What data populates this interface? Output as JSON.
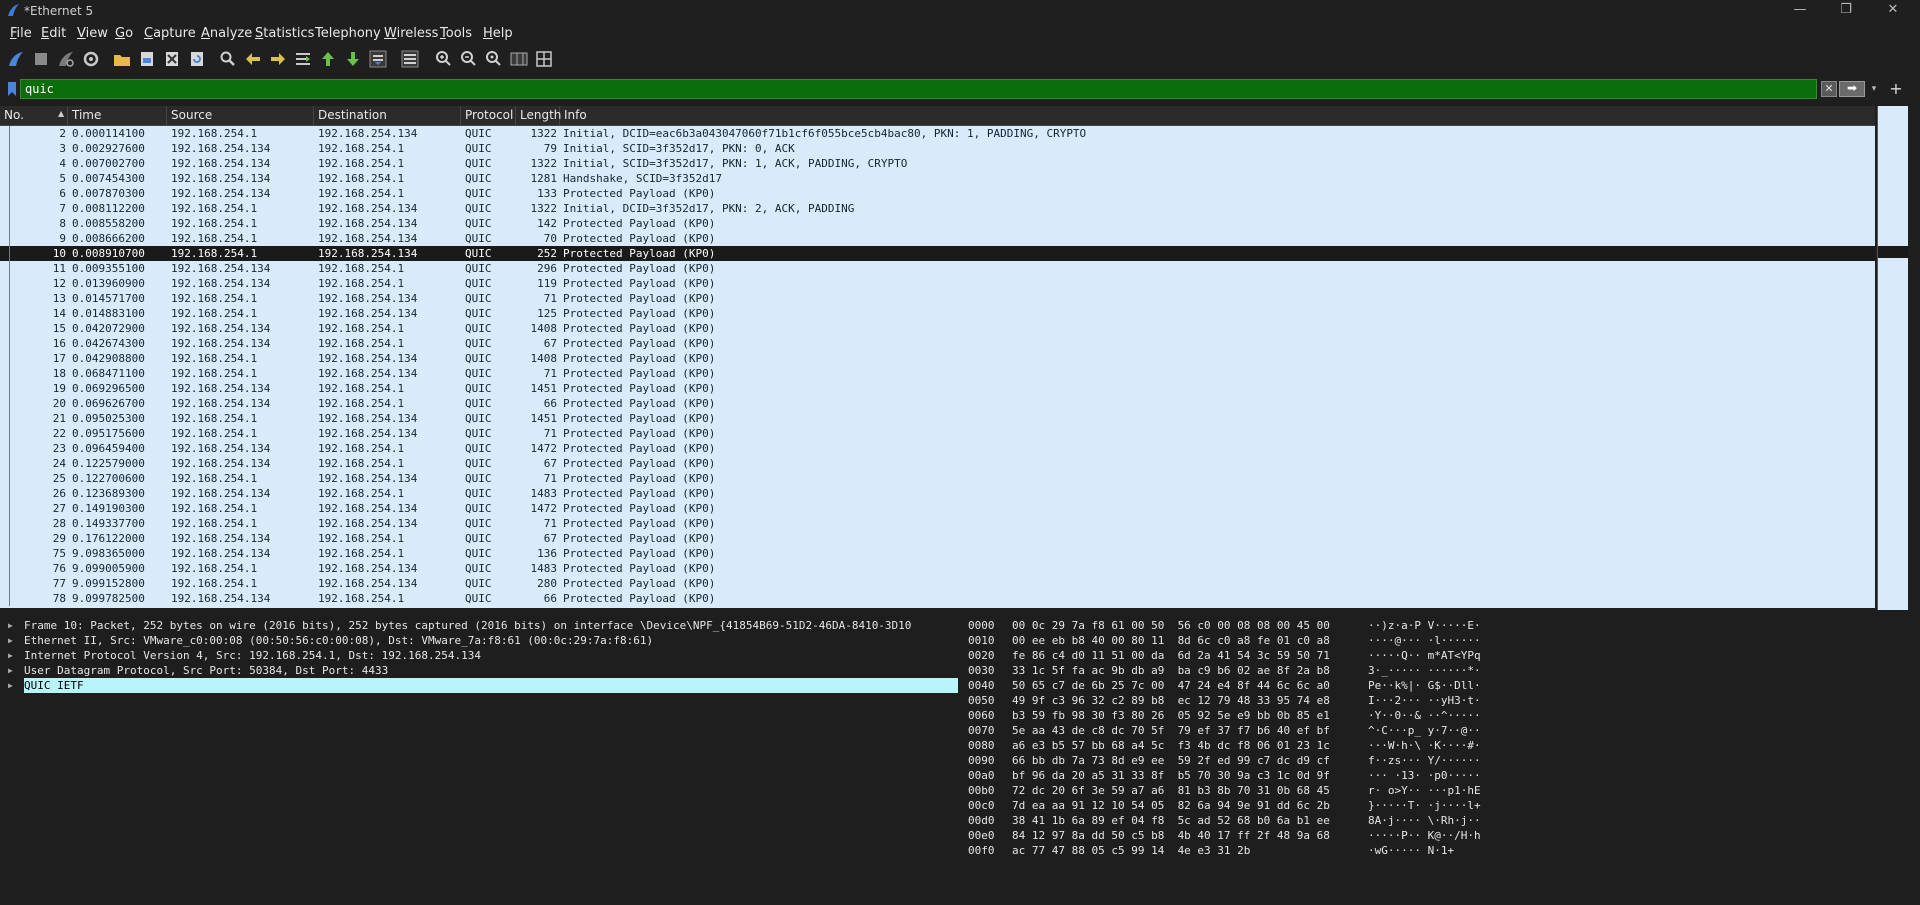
{
  "window": {
    "title": "*Ethernet 5",
    "minimize": "—",
    "maximize": "❐",
    "close": "✕"
  },
  "menu": [
    {
      "label": "File",
      "underline": "F",
      "rest": "ile"
    },
    {
      "label": "Edit",
      "underline": "E",
      "rest": "dit"
    },
    {
      "label": "View",
      "underline": "V",
      "rest": "iew"
    },
    {
      "label": "Go",
      "underline": "G",
      "rest": "o"
    },
    {
      "label": "Capture",
      "underline": "C",
      "rest": "apture"
    },
    {
      "label": "Analyze",
      "underline": "A",
      "rest": "nalyze"
    },
    {
      "label": "Statistics",
      "underline": "S",
      "rest": "tatistics"
    },
    {
      "label": "Telephony",
      "underline": "",
      "rest": "Telephony"
    },
    {
      "label": "Wireless",
      "underline": "W",
      "rest": "ireless"
    },
    {
      "label": "Tools",
      "underline": "T",
      "rest": "ools"
    },
    {
      "label": "Help",
      "underline": "H",
      "rest": "elp"
    }
  ],
  "toolbar_icons": [
    "shark-fin-start-icon",
    "stop-square-icon",
    "restart-fin-icon",
    "options-gear-icon",
    "open-folder-icon",
    "save-file-icon",
    "close-file-icon",
    "reload-icon",
    "find-packet-icon",
    "go-back-icon",
    "go-forward-icon",
    "go-to-packet-icon",
    "go-first-icon",
    "go-last-icon",
    "autoscroll-icon",
    "colorize-icon",
    "zoom-in-icon",
    "zoom-out-icon",
    "zoom-normal-icon",
    "resize-columns-icon",
    "layout-icon"
  ],
  "filter": {
    "value": "quic",
    "clear": "✕",
    "apply": "➡",
    "dropdown": "▾",
    "add": "+"
  },
  "columns": [
    "No.",
    "Time",
    "Source",
    "Destination",
    "Protocol",
    "Length",
    "Info"
  ],
  "packets": [
    {
      "no": "2",
      "time": "0.000114100",
      "src": "192.168.254.1",
      "dst": "192.168.254.134",
      "proto": "QUIC",
      "len": "1322",
      "info": "Initial, DCID=eac6b3a043047060f71b1cf6f055bce5cb4bac80, PKN: 1, PADDING, CRYPTO"
    },
    {
      "no": "3",
      "time": "0.002927600",
      "src": "192.168.254.134",
      "dst": "192.168.254.1",
      "proto": "QUIC",
      "len": "79",
      "info": "Initial, SCID=3f352d17, PKN: 0, ACK"
    },
    {
      "no": "4",
      "time": "0.007002700",
      "src": "192.168.254.134",
      "dst": "192.168.254.1",
      "proto": "QUIC",
      "len": "1322",
      "info": "Initial, SCID=3f352d17, PKN: 1, ACK, PADDING, CRYPTO"
    },
    {
      "no": "5",
      "time": "0.007454300",
      "src": "192.168.254.134",
      "dst": "192.168.254.1",
      "proto": "QUIC",
      "len": "1281",
      "info": "Handshake, SCID=3f352d17"
    },
    {
      "no": "6",
      "time": "0.007870300",
      "src": "192.168.254.134",
      "dst": "192.168.254.1",
      "proto": "QUIC",
      "len": "133",
      "info": "Protected Payload (KP0)"
    },
    {
      "no": "7",
      "time": "0.008112200",
      "src": "192.168.254.1",
      "dst": "192.168.254.134",
      "proto": "QUIC",
      "len": "1322",
      "info": "Initial, DCID=3f352d17, PKN: 2, ACK, PADDING"
    },
    {
      "no": "8",
      "time": "0.008558200",
      "src": "192.168.254.1",
      "dst": "192.168.254.134",
      "proto": "QUIC",
      "len": "142",
      "info": "Protected Payload (KP0)"
    },
    {
      "no": "9",
      "time": "0.008666200",
      "src": "192.168.254.1",
      "dst": "192.168.254.134",
      "proto": "QUIC",
      "len": "70",
      "info": "Protected Payload (KP0)"
    },
    {
      "no": "10",
      "time": "0.008910700",
      "src": "192.168.254.1",
      "dst": "192.168.254.134",
      "proto": "QUIC",
      "len": "252",
      "info": "Protected Payload (KP0)",
      "selected": true
    },
    {
      "no": "11",
      "time": "0.009355100",
      "src": "192.168.254.134",
      "dst": "192.168.254.1",
      "proto": "QUIC",
      "len": "296",
      "info": "Protected Payload (KP0)"
    },
    {
      "no": "12",
      "time": "0.013960900",
      "src": "192.168.254.134",
      "dst": "192.168.254.1",
      "proto": "QUIC",
      "len": "119",
      "info": "Protected Payload (KP0)"
    },
    {
      "no": "13",
      "time": "0.014571700",
      "src": "192.168.254.1",
      "dst": "192.168.254.134",
      "proto": "QUIC",
      "len": "71",
      "info": "Protected Payload (KP0)"
    },
    {
      "no": "14",
      "time": "0.014883100",
      "src": "192.168.254.1",
      "dst": "192.168.254.134",
      "proto": "QUIC",
      "len": "125",
      "info": "Protected Payload (KP0)"
    },
    {
      "no": "15",
      "time": "0.042072900",
      "src": "192.168.254.134",
      "dst": "192.168.254.1",
      "proto": "QUIC",
      "len": "1408",
      "info": "Protected Payload (KP0)"
    },
    {
      "no": "16",
      "time": "0.042674300",
      "src": "192.168.254.134",
      "dst": "192.168.254.1",
      "proto": "QUIC",
      "len": "67",
      "info": "Protected Payload (KP0)"
    },
    {
      "no": "17",
      "time": "0.042908800",
      "src": "192.168.254.1",
      "dst": "192.168.254.134",
      "proto": "QUIC",
      "len": "1408",
      "info": "Protected Payload (KP0)"
    },
    {
      "no": "18",
      "time": "0.068471100",
      "src": "192.168.254.1",
      "dst": "192.168.254.134",
      "proto": "QUIC",
      "len": "71",
      "info": "Protected Payload (KP0)"
    },
    {
      "no": "19",
      "time": "0.069296500",
      "src": "192.168.254.134",
      "dst": "192.168.254.1",
      "proto": "QUIC",
      "len": "1451",
      "info": "Protected Payload (KP0)"
    },
    {
      "no": "20",
      "time": "0.069626700",
      "src": "192.168.254.134",
      "dst": "192.168.254.1",
      "proto": "QUIC",
      "len": "66",
      "info": "Protected Payload (KP0)"
    },
    {
      "no": "21",
      "time": "0.095025300",
      "src": "192.168.254.1",
      "dst": "192.168.254.134",
      "proto": "QUIC",
      "len": "1451",
      "info": "Protected Payload (KP0)"
    },
    {
      "no": "22",
      "time": "0.095175600",
      "src": "192.168.254.1",
      "dst": "192.168.254.134",
      "proto": "QUIC",
      "len": "71",
      "info": "Protected Payload (KP0)"
    },
    {
      "no": "23",
      "time": "0.096459400",
      "src": "192.168.254.134",
      "dst": "192.168.254.1",
      "proto": "QUIC",
      "len": "1472",
      "info": "Protected Payload (KP0)"
    },
    {
      "no": "24",
      "time": "0.122579000",
      "src": "192.168.254.134",
      "dst": "192.168.254.1",
      "proto": "QUIC",
      "len": "67",
      "info": "Protected Payload (KP0)"
    },
    {
      "no": "25",
      "time": "0.122700600",
      "src": "192.168.254.1",
      "dst": "192.168.254.134",
      "proto": "QUIC",
      "len": "71",
      "info": "Protected Payload (KP0)"
    },
    {
      "no": "26",
      "time": "0.123689300",
      "src": "192.168.254.134",
      "dst": "192.168.254.1",
      "proto": "QUIC",
      "len": "1483",
      "info": "Protected Payload (KP0)"
    },
    {
      "no": "27",
      "time": "0.149190300",
      "src": "192.168.254.1",
      "dst": "192.168.254.134",
      "proto": "QUIC",
      "len": "1472",
      "info": "Protected Payload (KP0)"
    },
    {
      "no": "28",
      "time": "0.149337700",
      "src": "192.168.254.1",
      "dst": "192.168.254.134",
      "proto": "QUIC",
      "len": "71",
      "info": "Protected Payload (KP0)"
    },
    {
      "no": "29",
      "time": "0.176122000",
      "src": "192.168.254.134",
      "dst": "192.168.254.1",
      "proto": "QUIC",
      "len": "67",
      "info": "Protected Payload (KP0)"
    },
    {
      "no": "75",
      "time": "9.098365000",
      "src": "192.168.254.134",
      "dst": "192.168.254.1",
      "proto": "QUIC",
      "len": "136",
      "info": "Protected Payload (KP0)"
    },
    {
      "no": "76",
      "time": "9.099005900",
      "src": "192.168.254.1",
      "dst": "192.168.254.134",
      "proto": "QUIC",
      "len": "1483",
      "info": "Protected Payload (KP0)"
    },
    {
      "no": "77",
      "time": "9.099152800",
      "src": "192.168.254.1",
      "dst": "192.168.254.134",
      "proto": "QUIC",
      "len": "280",
      "info": "Protected Payload (KP0)"
    },
    {
      "no": "78",
      "time": "9.099782500",
      "src": "192.168.254.134",
      "dst": "192.168.254.1",
      "proto": "QUIC",
      "len": "66",
      "info": "Protected Payload (KP0)"
    }
  ],
  "details": [
    {
      "text": "Frame 10: Packet, 252 bytes on wire (2016 bits), 252 bytes captured (2016 bits) on interface \\Device\\NPF_{41854B69-51D2-46DA-8410-3D10"
    },
    {
      "text": "Ethernet II, Src: VMware_c0:00:08 (00:50:56:c0:00:08), Dst: VMware_7a:f8:61 (00:0c:29:7a:f8:61)"
    },
    {
      "text": "Internet Protocol Version 4, Src: 192.168.254.1, Dst: 192.168.254.134"
    },
    {
      "text": "User Datagram Protocol, Src Port: 50384, Dst Port: 4433"
    },
    {
      "text": "QUIC IETF",
      "selected": true
    }
  ],
  "bytes": [
    {
      "off": "0000",
      "hex": "00 0c 29 7a f8 61 00 50  56 c0 00 08 08 00 45 00",
      "asc": "··)z·a·P V·····E·"
    },
    {
      "off": "0010",
      "hex": "00 ee eb b8 40 00 80 11  8d 6c c0 a8 fe 01 c0 a8",
      "asc": "····@··· ·l······"
    },
    {
      "off": "0020",
      "hex": "fe 86 c4 d0 11 51 00 da  6d 2a 41 54 3c 59 50 71",
      "asc": "·····Q·· m*AT<YPq"
    },
    {
      "off": "0030",
      "hex": "33 1c 5f fa ac 9b db a9  ba c9 b6 02 ae 8f 2a b8",
      "asc": "3·_····· ······*·"
    },
    {
      "off": "0040",
      "hex": "50 65 c7 de 6b 25 7c 00  47 24 e4 8f 44 6c 6c a0",
      "asc": "Pe··k%|· G$··Dll·"
    },
    {
      "off": "0050",
      "hex": "49 9f c3 96 32 c2 89 b8  ec 12 79 48 33 95 74 e8",
      "asc": "I···2··· ··yH3·t·"
    },
    {
      "off": "0060",
      "hex": "b3 59 fb 98 30 f3 80 26  05 92 5e e9 bb 0b 85 e1",
      "asc": "·Y··0··& ··^·····"
    },
    {
      "off": "0070",
      "hex": "5e aa 43 de c8 dc 70 5f  79 ef 37 f7 b6 40 ef bf",
      "asc": "^·C···p_ y·7··@··"
    },
    {
      "off": "0080",
      "hex": "a6 e3 b5 57 bb 68 a4 5c  f3 4b dc f8 06 01 23 1c",
      "asc": "···W·h·\\ ·K····#·"
    },
    {
      "off": "0090",
      "hex": "66 bb db 7a 73 8d e9 ee  59 2f ed 99 c7 dc d9 cf",
      "asc": "f··zs··· Y/······"
    },
    {
      "off": "00a0",
      "hex": "bf 96 da 20 a5 31 33 8f  b5 70 30 9a c3 1c 0d 9f",
      "asc": "··· ·13· ·p0·····"
    },
    {
      "off": "00b0",
      "hex": "72 dc 20 6f 3e 59 a7 a6  81 b3 8b 70 31 0b 68 45",
      "asc": "r· o>Y·· ···p1·hE"
    },
    {
      "off": "00c0",
      "hex": "7d ea aa 91 12 10 54 05  82 6a 94 9e 91 dd 6c 2b",
      "asc": "}·····T· ·j····l+"
    },
    {
      "off": "00d0",
      "hex": "38 41 1b 6a 89 ef 04 f8  5c ad 52 68 b0 6a b1 ee",
      "asc": "8A·j···· \\·Rh·j··"
    },
    {
      "off": "00e0",
      "hex": "84 12 97 8a dd 50 c5 b8  4b 40 17 ff 2f 48 9a 68",
      "asc": "·····P·· K@··/H·h"
    },
    {
      "off": "00f0",
      "hex": "ac 77 47 88 05 c5 99 14  4e e3 31 2b",
      "asc": "·wG····· N·1+"
    }
  ],
  "colors": {
    "background": "#1e1e1e",
    "packet_row": "#d9eafa",
    "selected_row": "#1a1a1a",
    "filter_valid": "#0a6f0a",
    "selected_detail": "#b8f5f9"
  }
}
